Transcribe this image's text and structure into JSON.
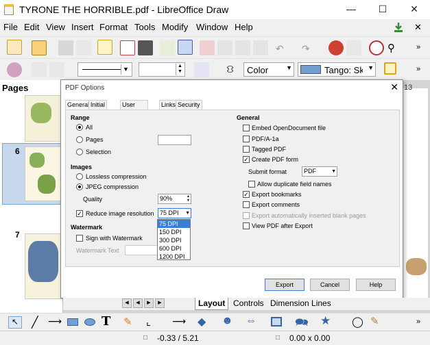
{
  "window": {
    "title": "TYRONE THE HORRIBLE.pdf - LibreOffice Draw"
  },
  "menu": [
    "File",
    "Edit",
    "View",
    "Insert",
    "Format",
    "Tools",
    "Modify",
    "Window",
    "Help"
  ],
  "format_toolbar": {
    "line_style_value": "",
    "width_value": "",
    "fill_type": "Color",
    "fill_color_name": "Tango: Sky"
  },
  "pages_panel": {
    "header": "Pages",
    "page_numbers": [
      "6",
      "7"
    ]
  },
  "side_text": {
    "number": "13"
  },
  "dialog": {
    "title": "PDF Options",
    "tabs": [
      "General",
      "Initial View",
      "User Interface",
      "Links",
      "Security"
    ],
    "range": {
      "heading": "Range",
      "all": "All",
      "pages": "Pages",
      "selection": "Selection"
    },
    "images": {
      "heading": "Images",
      "lossless": "Lossless compression",
      "jpeg": "JPEG compression",
      "quality_label": "Quality",
      "quality_value": "90%",
      "reduce_label": "Reduce image resolution",
      "resolution_value": "75 DPI",
      "resolution_options": [
        "75 DPI",
        "150 DPI",
        "300 DPI",
        "600 DPI",
        "1200 DPI"
      ]
    },
    "watermark": {
      "heading": "Watermark",
      "sign_label": "Sign with Watermark",
      "text_label": "Watermark Text"
    },
    "general": {
      "heading": "General",
      "embed_odf": "Embed OpenDocument file",
      "pdfa": "PDF/A-1a",
      "tagged": "Tagged PDF",
      "create_form": "Create PDF form",
      "submit_format_label": "Submit format",
      "submit_format_value": "PDF",
      "allow_duplicate": "Allow duplicate field names",
      "export_bookmarks": "Export bookmarks",
      "export_comments": "Export comments",
      "export_blank": "Export automatically inserted blank pages",
      "view_after": "View PDF after Export"
    },
    "buttons": {
      "export": "Export",
      "cancel": "Cancel",
      "help": "Help"
    }
  },
  "layout_tabs": [
    "Layout",
    "Controls",
    "Dimension Lines"
  ],
  "status": {
    "position": "-0.33 / 5.21",
    "size": "0.00 x 0.00"
  },
  "colors": {
    "accent": "#3b7dd8",
    "fill_swatch": "#729fcf"
  }
}
